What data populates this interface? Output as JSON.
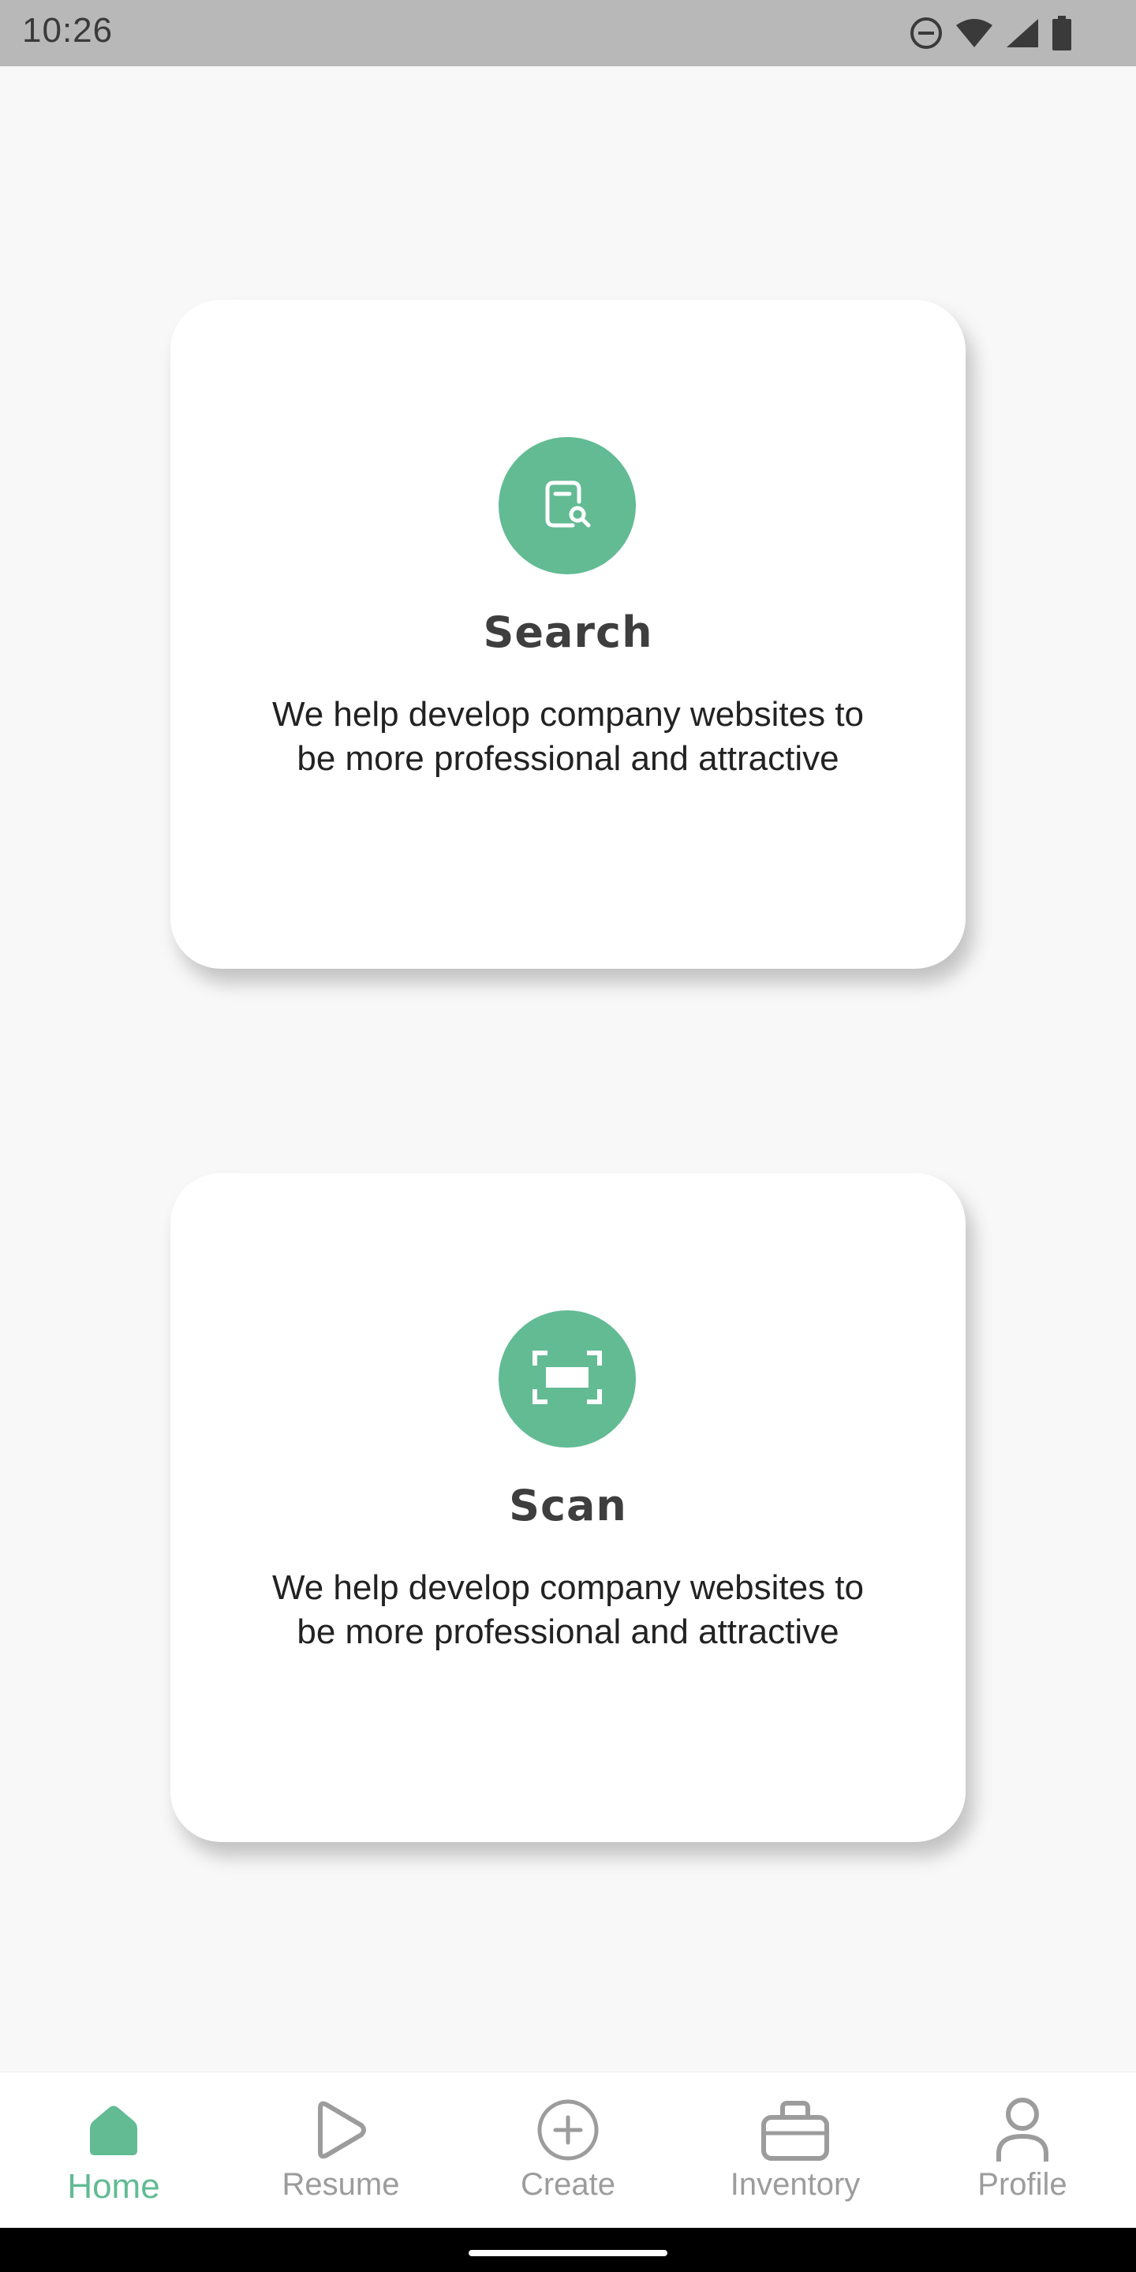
{
  "status_bar": {
    "time": "10:26",
    "icons": [
      "do-not-disturb-icon",
      "wifi-icon",
      "signal-icon",
      "battery-icon"
    ]
  },
  "cards": [
    {
      "icon": "document-search-icon",
      "title": "Search",
      "description": "We help develop company websites to be more professional and attractive"
    },
    {
      "icon": "scan-frame-icon",
      "title": "Scan",
      "description": "We help develop company websites to be more professional and attractive"
    }
  ],
  "bottom_nav": {
    "items": [
      {
        "label": "Home",
        "icon": "home-icon",
        "active": true
      },
      {
        "label": "Resume",
        "icon": "play-icon",
        "active": false
      },
      {
        "label": "Create",
        "icon": "plus-circle-icon",
        "active": false
      },
      {
        "label": "Inventory",
        "icon": "briefcase-icon",
        "active": false
      },
      {
        "label": "Profile",
        "icon": "user-icon",
        "active": false
      }
    ]
  },
  "colors": {
    "accent": "#62bb93",
    "inactive": "#9c9c9c",
    "background": "#f8f8f8",
    "status_bar": "#b8b8b8"
  }
}
